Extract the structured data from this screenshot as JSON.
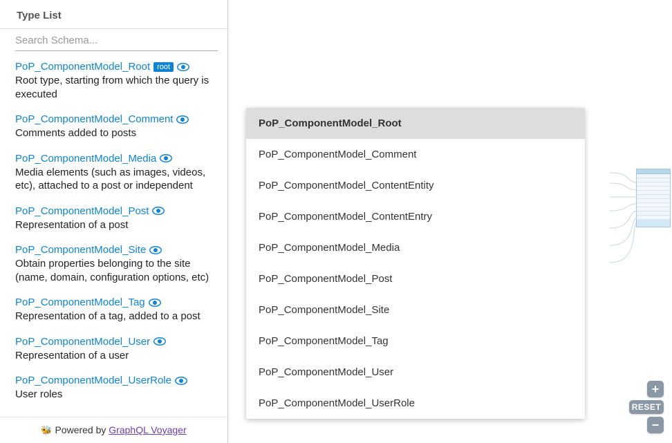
{
  "sidebar": {
    "title": "Type List",
    "search_placeholder": "Search Schema...",
    "items": [
      {
        "name": "PoP_ComponentModel_Root",
        "is_root": true,
        "root_label": "root",
        "desc": "Root type, starting from which the query is executed"
      },
      {
        "name": "PoP_ComponentModel_Comment",
        "is_root": false,
        "desc": "Comments added to posts"
      },
      {
        "name": "PoP_ComponentModel_Media",
        "is_root": false,
        "desc": "Media elements (such as images, videos, etc), attached to a post or independent"
      },
      {
        "name": "PoP_ComponentModel_Post",
        "is_root": false,
        "desc": "Representation of a post"
      },
      {
        "name": "PoP_ComponentModel_Site",
        "is_root": false,
        "desc": "Obtain properties belonging to the site (name, domain, configuration options, etc)"
      },
      {
        "name": "PoP_ComponentModel_Tag",
        "is_root": false,
        "desc": "Representation of a tag, added to a post"
      },
      {
        "name": "PoP_ComponentModel_User",
        "is_root": false,
        "desc": "Representation of a user"
      },
      {
        "name": "PoP_ComponentModel_UserRole",
        "is_root": false,
        "desc": "User roles"
      }
    ],
    "footer_prefix": "Powered by ",
    "footer_link": "GraphQL Voyager"
  },
  "dropdown": {
    "selected": "PoP_ComponentModel_Root",
    "options": [
      "PoP_ComponentModel_Comment",
      "PoP_ComponentModel_ContentEntity",
      "PoP_ComponentModel_ContentEntry",
      "PoP_ComponentModel_Media",
      "PoP_ComponentModel_Post",
      "PoP_ComponentModel_Site",
      "PoP_ComponentModel_Tag",
      "PoP_ComponentModel_User",
      "PoP_ComponentModel_UserRole"
    ]
  },
  "controls": {
    "zoom_in": "+",
    "reset": "RESET",
    "zoom_out": "−"
  }
}
